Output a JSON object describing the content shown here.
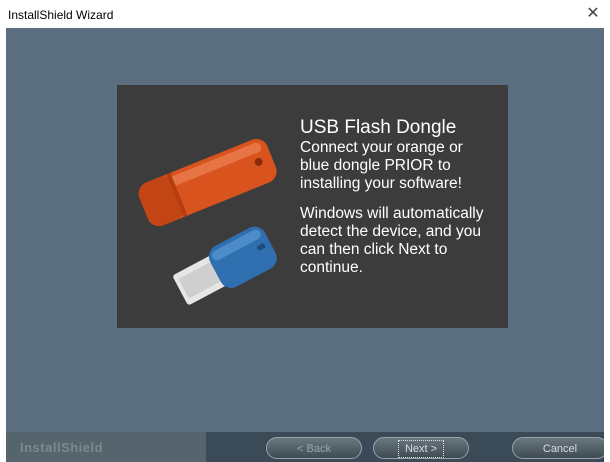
{
  "window": {
    "title": "InstallShield Wizard",
    "close_icon": "close-icon"
  },
  "banner": {
    "headline": "USB Flash Dongle",
    "instruction_lines": [
      "Connect your orange or",
      "blue dongle PRIOR to",
      "installing your software!"
    ],
    "info_lines": [
      "Windows will automatically",
      "detect the device, and you",
      "can then click Next to",
      "continue."
    ],
    "art": [
      "usb-dongle-orange",
      "usb-dongle-blue"
    ]
  },
  "footer": {
    "brand": "InstallShield",
    "back_label": "< Back",
    "next_label": "Next >",
    "cancel_label": "Cancel"
  },
  "colors": {
    "client_background": "#5c6f80",
    "banner_background": "#3c3c3c",
    "footer_background": "#3a4a56",
    "orange_dongle": "#d9531e",
    "blue_dongle": "#2f6fb0"
  }
}
